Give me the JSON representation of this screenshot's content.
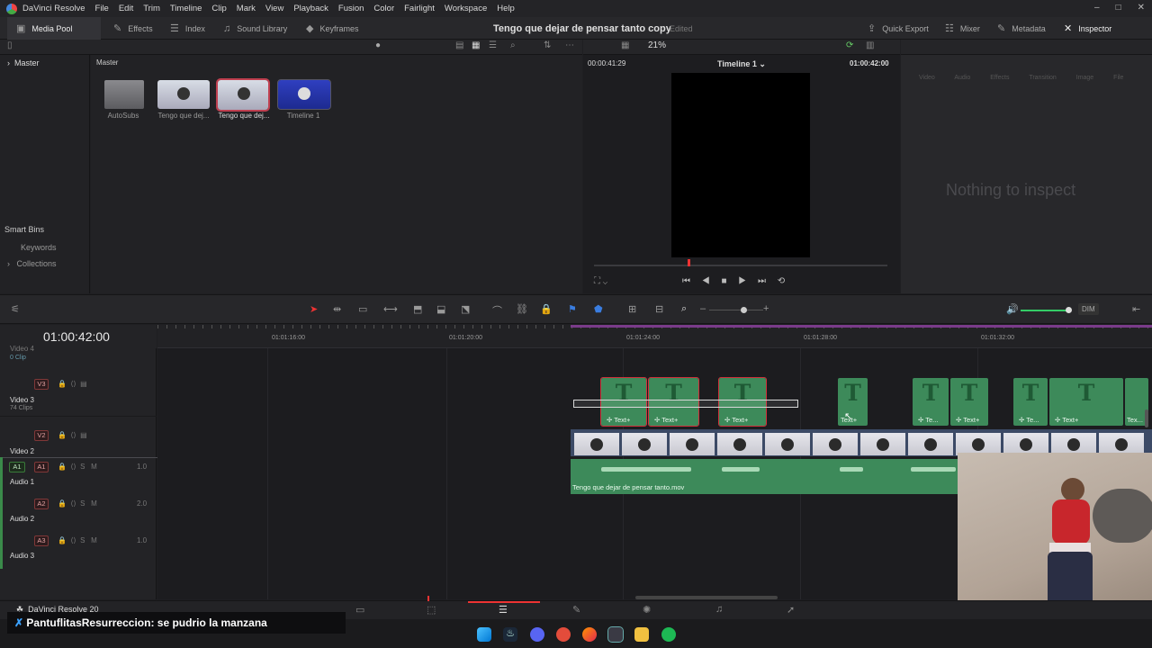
{
  "app": {
    "name": "DaVinci Resolve",
    "menu": [
      "File",
      "Edit",
      "Trim",
      "Timeline",
      "Clip",
      "Mark",
      "View",
      "Playback",
      "Fusion",
      "Color",
      "Fairlight",
      "Workspace",
      "Help"
    ]
  },
  "toolbar": {
    "media_pool": "Media Pool",
    "effects": "Effects",
    "index": "Index",
    "sound_library": "Sound Library",
    "keyframes": "Keyframes",
    "project_title": "Tengo que dejar de pensar tanto copy",
    "edited": "Edited",
    "quick_export": "Quick Export",
    "mixer": "Mixer",
    "metadata": "Metadata",
    "inspector": "Inspector"
  },
  "viewer": {
    "zoom": "21%",
    "timecode_left": "00:00:41:29",
    "timeline_name": "Timeline 1",
    "timecode_right": "01:00:42:00"
  },
  "bins": {
    "master": "Master",
    "smart_bins": "Smart Bins",
    "keywords": "Keywords",
    "collections": "Collections"
  },
  "pool": {
    "header": "Master",
    "items": [
      {
        "label": "AutoSubs"
      },
      {
        "label": "Tengo que dej..."
      },
      {
        "label": "Tengo que dej..."
      },
      {
        "label": "Timeline 1"
      }
    ]
  },
  "inspector": {
    "tabs": [
      "Video",
      "Audio",
      "Effects",
      "Transition",
      "Image",
      "File"
    ],
    "empty": "Nothing to inspect"
  },
  "timeline": {
    "timecode": "01:00:42:00",
    "ruler": [
      "01:01:16:00",
      "01:01:20:00",
      "01:01:24:00",
      "01:01:28:00",
      "01:01:32:00"
    ],
    "dim": "DIM",
    "tracks": [
      {
        "name": "Video 4",
        "sub": "0 Clip"
      },
      {
        "badge": "V3",
        "name": "Video 3",
        "sub": "74 Clips"
      },
      {
        "badge": "V2",
        "name": "Video 2"
      },
      {
        "src": "A1",
        "badge": "A1",
        "name": "Audio 1",
        "vol": "1.0"
      },
      {
        "badge": "A2",
        "name": "Audio 2",
        "vol": "2.0"
      },
      {
        "badge": "A3",
        "name": "Audio 3",
        "vol": "1.0"
      }
    ],
    "text_clips": [
      "Text+",
      "Text+",
      "Text+",
      "Text+",
      "Te...",
      "Text+",
      "Te...",
      "Text+",
      "Tex..."
    ],
    "audio_clip": "Tengo que dejar de pensar tanto.mov"
  },
  "bottom": {
    "version": "DaVinci Resolve 20"
  },
  "chat": {
    "user": "PantuflitasResurreccion",
    "message": "se pudrio la manzana"
  }
}
